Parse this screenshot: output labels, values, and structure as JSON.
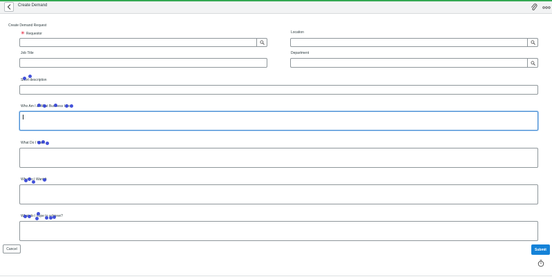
{
  "header": {
    "title": "Create Demand"
  },
  "form": {
    "section_title": "Create Demand Request",
    "requestor_label": "Requestor",
    "location_label": "Location",
    "job_title_label": "Job Title",
    "department_label": "Department",
    "short_description_label": "Short description",
    "q1_label": "Who Am I & What Business I Do",
    "q2_label": "What Do I Want",
    "q3_label": "Why Do I Want It",
    "q4_label": "What do I hope to achieve?"
  },
  "footer": {
    "cancel_label": "Cancel",
    "submit_label": "Submit"
  },
  "colors": {
    "accent": "#1482d8",
    "required": "#e0001e",
    "focus": "#4b8fd4"
  },
  "icons": [
    "chevron-left-icon",
    "paperclip-icon",
    "more-icon",
    "search-icon",
    "timer-icon"
  ]
}
